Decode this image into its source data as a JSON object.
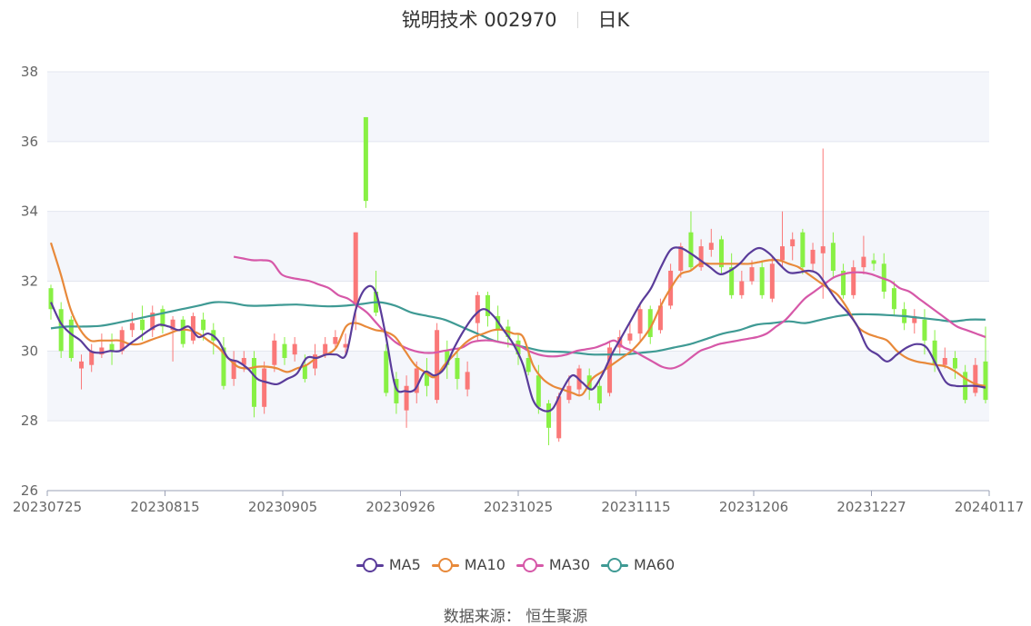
{
  "chart_data": {
    "type": "candlestick",
    "title": "锐明技术 002970",
    "period_label": "日K",
    "source_label": "数据来源：",
    "source_name": "恒生聚源",
    "ylim": [
      26,
      38
    ],
    "y_ticks": [
      26,
      28,
      30,
      32,
      34,
      36,
      38
    ],
    "x_tick_labels": [
      "20230725",
      "20230815",
      "20230905",
      "20230926",
      "20231025",
      "20231115",
      "20231206",
      "20231227",
      "20240117"
    ],
    "grid": "horizontal",
    "legend_position": "bottom",
    "up_color": "#fa7878",
    "down_color": "#88f044",
    "series": [
      {
        "name": "MA5",
        "color": "#5a3c9a",
        "values": [
          31.4,
          30.8,
          30.5,
          30.3,
          30.0,
          29.95,
          30.0,
          30.0,
          30.2,
          30.4,
          30.6,
          30.75,
          30.7,
          30.6,
          30.7,
          30.4,
          30.5,
          30.3,
          29.8,
          29.7,
          29.5,
          29.2,
          29.1,
          29.05,
          29.2,
          29.35,
          29.8,
          29.8,
          29.9,
          29.9,
          29.9,
          31.2,
          31.8,
          31.7,
          30.5,
          29.0,
          28.85,
          28.9,
          29.4,
          29.3,
          29.5,
          30.1,
          30.6,
          31.0,
          31.2,
          31.0,
          30.6,
          30.2,
          29.6,
          28.6,
          28.3,
          28.35,
          28.9,
          29.3,
          29.1,
          28.9,
          29.3,
          29.9,
          30.4,
          30.9,
          31.4,
          31.8,
          32.4,
          32.9,
          32.95,
          32.8,
          32.6,
          32.4,
          32.2,
          32.3,
          32.5,
          32.8,
          32.95,
          32.8,
          32.5,
          32.25,
          32.25,
          32.3,
          32.2,
          31.8,
          31.4,
          31.1,
          30.7,
          30.1,
          29.9,
          29.7,
          29.9,
          30.1,
          30.2,
          30.1,
          29.6,
          29.1,
          29.0,
          29.0,
          29.0,
          28.95
        ]
      },
      {
        "name": "MA10",
        "color": "#e8893a",
        "values": [
          33.1,
          32.2,
          31.2,
          30.6,
          30.3,
          30.3,
          30.3,
          30.3,
          30.2,
          30.2,
          30.3,
          30.4,
          30.5,
          30.6,
          30.6,
          30.5,
          30.3,
          30.1,
          29.8,
          29.55,
          29.5,
          29.55,
          29.55,
          29.5,
          29.4,
          29.5,
          29.6,
          29.8,
          29.9,
          30.1,
          30.7,
          30.8,
          30.7,
          30.6,
          30.55,
          30.4,
          30.0,
          29.6,
          29.4,
          29.25,
          29.6,
          29.9,
          30.2,
          30.4,
          30.5,
          30.6,
          30.6,
          30.5,
          30.4,
          29.6,
          29.2,
          29.0,
          28.9,
          28.8,
          28.75,
          29.2,
          29.4,
          29.6,
          29.8,
          30.0,
          30.3,
          30.7,
          31.3,
          31.8,
          32.2,
          32.3,
          32.5,
          32.5,
          32.5,
          32.5,
          32.5,
          32.5,
          32.55,
          32.6,
          32.6,
          32.5,
          32.4,
          32.2,
          32.0,
          31.8,
          31.6,
          31.2,
          30.7,
          30.5,
          30.4,
          30.3,
          30.0,
          29.8,
          29.7,
          29.65,
          29.6,
          29.55,
          29.4,
          29.2,
          29.05,
          29.0
        ]
      },
      {
        "name": "MA30",
        "color": "#d658a8",
        "values": [
          32.7,
          32.65,
          32.6,
          32.6,
          32.55,
          32.2,
          32.1,
          32.05,
          32.0,
          31.9,
          31.8,
          31.6,
          31.5,
          31.3,
          31.1,
          30.8,
          30.5,
          30.25,
          30.1,
          30.0,
          29.95,
          29.95,
          30.0,
          30.05,
          30.1,
          30.25,
          30.3,
          30.3,
          30.25,
          30.2,
          30.15,
          30.0,
          29.9,
          29.85,
          29.85,
          29.9,
          30.0,
          30.05,
          30.1,
          30.2,
          30.3,
          30.1,
          30.0,
          29.85,
          29.7,
          29.55,
          29.5,
          29.6,
          29.8,
          30.0,
          30.1,
          30.2,
          30.25,
          30.3,
          30.35,
          30.4,
          30.5,
          30.7,
          30.9,
          31.2,
          31.5,
          31.7,
          31.9,
          32.1,
          32.2,
          32.25,
          32.25,
          32.2,
          32.1,
          32.0,
          31.8,
          31.7,
          31.5,
          31.3,
          31.1,
          30.9,
          30.7,
          30.6,
          30.5,
          30.4
        ],
        "start_index": 18
      },
      {
        "name": "MA60",
        "color": "#3f9a94",
        "values": [
          30.65,
          30.7,
          30.7,
          30.72,
          30.8,
          30.9,
          31.0,
          31.1,
          31.2,
          31.3,
          31.4,
          31.38,
          31.3,
          31.3,
          31.32,
          31.33,
          31.3,
          31.28,
          31.3,
          31.35,
          31.4,
          31.3,
          31.1,
          31.0,
          30.9,
          30.7,
          30.5,
          30.3,
          30.2,
          30.1,
          30.0,
          29.98,
          29.95,
          29.9,
          29.9,
          29.9,
          29.95,
          30.0,
          30.1,
          30.2,
          30.35,
          30.5,
          30.6,
          30.75,
          30.8,
          30.85,
          30.8,
          30.9,
          31.0,
          31.05,
          31.05,
          31.03,
          31.0,
          30.95,
          30.9,
          30.85,
          30.9,
          30.9
        ],
        "start_index": 0
      }
    ],
    "candles": [
      [
        31.8,
        31.2,
        31.9,
        30.9
      ],
      [
        31.2,
        30.0,
        31.4,
        29.8
      ],
      [
        30.9,
        29.8,
        31.0,
        29.7
      ],
      [
        29.5,
        29.7,
        29.9,
        28.9
      ],
      [
        29.6,
        30.0,
        30.2,
        29.4
      ],
      [
        29.9,
        30.1,
        30.5,
        29.8
      ],
      [
        30.2,
        30.0,
        30.5,
        29.6
      ],
      [
        30.0,
        30.6,
        30.7,
        29.9
      ],
      [
        30.6,
        30.8,
        31.1,
        30.4
      ],
      [
        30.9,
        30.6,
        31.3,
        30.3
      ],
      [
        30.6,
        31.1,
        31.3,
        30.4
      ],
      [
        31.2,
        30.7,
        31.3,
        30.5
      ],
      [
        30.6,
        30.9,
        31.0,
        29.7
      ],
      [
        30.9,
        30.2,
        31.0,
        30.1
      ],
      [
        30.3,
        31.0,
        31.1,
        30.2
      ],
      [
        30.9,
        30.6,
        31.1,
        30.3
      ],
      [
        30.6,
        30.3,
        30.8,
        29.9
      ],
      [
        30.1,
        29.0,
        30.4,
        28.9
      ],
      [
        29.2,
        29.7,
        30.0,
        29.0
      ],
      [
        29.6,
        29.8,
        30.0,
        29.4
      ],
      [
        29.8,
        28.4,
        30.0,
        28.1
      ],
      [
        28.4,
        29.5,
        29.7,
        28.2
      ],
      [
        29.6,
        30.3,
        30.5,
        29.4
      ],
      [
        30.2,
        29.8,
        30.4,
        29.6
      ],
      [
        29.9,
        30.2,
        30.4,
        29.7
      ],
      [
        29.6,
        29.2,
        29.9,
        29.1
      ],
      [
        29.5,
        29.9,
        30.2,
        29.3
      ],
      [
        29.9,
        30.2,
        30.4,
        29.8
      ],
      [
        30.2,
        30.4,
        30.6,
        30.1
      ],
      [
        30.1,
        30.2,
        30.5,
        29.9
      ],
      [
        31.3,
        33.4,
        33.4,
        30.6
      ],
      [
        36.7,
        34.3,
        36.7,
        34.1
      ],
      [
        31.7,
        31.1,
        32.3,
        31.0
      ],
      [
        30.0,
        28.8,
        30.2,
        28.7
      ],
      [
        29.2,
        28.5,
        29.4,
        28.2
      ],
      [
        28.3,
        29.0,
        29.3,
        27.8
      ],
      [
        28.8,
        29.5,
        29.7,
        28.5
      ],
      [
        29.4,
        29.0,
        29.8,
        28.7
      ],
      [
        28.6,
        30.6,
        30.8,
        28.5
      ],
      [
        30.0,
        29.6,
        30.3,
        29.2
      ],
      [
        29.8,
        29.2,
        30.0,
        28.9
      ],
      [
        28.9,
        29.4,
        29.7,
        28.7
      ],
      [
        30.8,
        31.6,
        31.7,
        30.3
      ],
      [
        31.6,
        31.0,
        31.7,
        30.7
      ],
      [
        31.0,
        30.6,
        31.3,
        30.3
      ],
      [
        30.7,
        30.4,
        30.9,
        30.1
      ],
      [
        30.3,
        29.9,
        30.5,
        29.6
      ],
      [
        29.8,
        29.4,
        30.0,
        29.3
      ],
      [
        29.3,
        28.4,
        29.6,
        28.2
      ],
      [
        28.5,
        27.8,
        28.6,
        27.3
      ],
      [
        27.5,
        28.7,
        28.8,
        27.4
      ],
      [
        28.6,
        29.0,
        29.3,
        28.5
      ],
      [
        28.9,
        29.5,
        29.6,
        28.7
      ],
      [
        29.3,
        28.9,
        29.5,
        28.6
      ],
      [
        29.0,
        28.5,
        29.2,
        28.3
      ],
      [
        28.8,
        30.1,
        30.3,
        28.7
      ],
      [
        30.1,
        30.4,
        30.6,
        29.9
      ],
      [
        30.3,
        30.5,
        30.8,
        30.2
      ],
      [
        30.5,
        31.2,
        31.4,
        30.3
      ],
      [
        31.2,
        30.4,
        31.3,
        30.2
      ],
      [
        30.6,
        31.3,
        31.5,
        30.5
      ],
      [
        31.3,
        32.3,
        32.5,
        31.2
      ],
      [
        32.3,
        33.0,
        33.1,
        32.1
      ],
      [
        33.4,
        32.4,
        34.0,
        32.3
      ],
      [
        32.4,
        33.0,
        33.2,
        32.3
      ],
      [
        32.9,
        33.1,
        33.5,
        32.7
      ],
      [
        33.2,
        32.4,
        33.3,
        32.2
      ],
      [
        32.4,
        31.6,
        32.8,
        31.5
      ],
      [
        31.6,
        32.0,
        32.3,
        31.5
      ],
      [
        32.0,
        32.4,
        32.6,
        31.9
      ],
      [
        32.4,
        31.6,
        32.6,
        31.5
      ],
      [
        31.5,
        32.5,
        32.7,
        31.4
      ],
      [
        32.6,
        33.0,
        34.0,
        32.4
      ],
      [
        33.0,
        33.2,
        33.4,
        32.6
      ],
      [
        33.4,
        32.4,
        33.5,
        32.2
      ],
      [
        32.5,
        32.9,
        33.1,
        32.3
      ],
      [
        32.8,
        33.0,
        35.8,
        31.5
      ],
      [
        33.1,
        32.3,
        33.4,
        32.1
      ],
      [
        32.3,
        31.6,
        32.5,
        31.5
      ],
      [
        31.6,
        32.4,
        32.6,
        31.5
      ],
      [
        32.4,
        32.7,
        33.3,
        32.2
      ],
      [
        32.6,
        32.5,
        32.8,
        32.3
      ],
      [
        32.5,
        31.7,
        32.8,
        31.5
      ],
      [
        31.8,
        31.2,
        32.0,
        31.0
      ],
      [
        31.2,
        30.8,
        31.4,
        30.6
      ],
      [
        30.8,
        31.0,
        31.2,
        30.5
      ],
      [
        30.9,
        30.3,
        31.2,
        29.9
      ],
      [
        30.3,
        29.6,
        30.6,
        29.4
      ],
      [
        29.6,
        29.8,
        30.1,
        29.5
      ],
      [
        29.8,
        29.5,
        30.0,
        29.2
      ],
      [
        29.4,
        28.6,
        29.6,
        28.5
      ],
      [
        28.8,
        29.6,
        29.8,
        28.7
      ],
      [
        29.7,
        28.6,
        30.7,
        28.5
      ]
    ]
  }
}
